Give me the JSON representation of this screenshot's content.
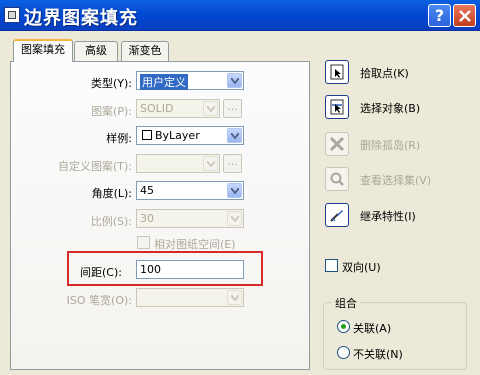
{
  "window": {
    "title": "边界图案填充",
    "help_label": "?"
  },
  "tabs": [
    {
      "label": "图案填充",
      "active": true
    },
    {
      "label": "高级",
      "active": false
    },
    {
      "label": "渐变色",
      "active": false
    }
  ],
  "fields": {
    "type": {
      "label": "类型(Y):",
      "value": "用户定义"
    },
    "pattern": {
      "label": "图案(P):",
      "value": "SOLID",
      "button": "..."
    },
    "swatch": {
      "label": "样例:",
      "value": "ByLayer"
    },
    "custom_pattern": {
      "label": "自定义图案(T):",
      "value": "",
      "button": "..."
    },
    "angle": {
      "label": "角度(L):",
      "value": "45"
    },
    "scale": {
      "label": "比例(S):",
      "value": "30"
    },
    "relative": {
      "label": "相对图纸空间(E)",
      "checked": false
    },
    "spacing": {
      "label": "间距(C):",
      "value": "100"
    },
    "iso_pen": {
      "label": "ISO 笔宽(O):",
      "value": ""
    }
  },
  "side": {
    "pick_points": "拾取点(K)",
    "select_objects": "选择对象(B)",
    "remove_islands": "删除孤岛(R)",
    "view_selections": "查看选择集(V)",
    "inherit": "继承特性(I)",
    "double": {
      "label": "双向(U)",
      "checked": false
    }
  },
  "composition": {
    "title": "组合",
    "associative": {
      "label": "关联(A)",
      "selected": true
    },
    "nonassociative": {
      "label": "不关联(N)",
      "selected": false
    }
  },
  "colors": {
    "titlebar": "#0046d0",
    "highlight": "#316ac5",
    "annotation": "#d42a2a"
  },
  "icons": [
    "pick-point-icon",
    "select-objects-icon",
    "remove-islands-icon",
    "view-selections-icon",
    "inherit-properties-icon",
    "help-icon",
    "close-icon",
    "chevron-down-icon"
  ]
}
